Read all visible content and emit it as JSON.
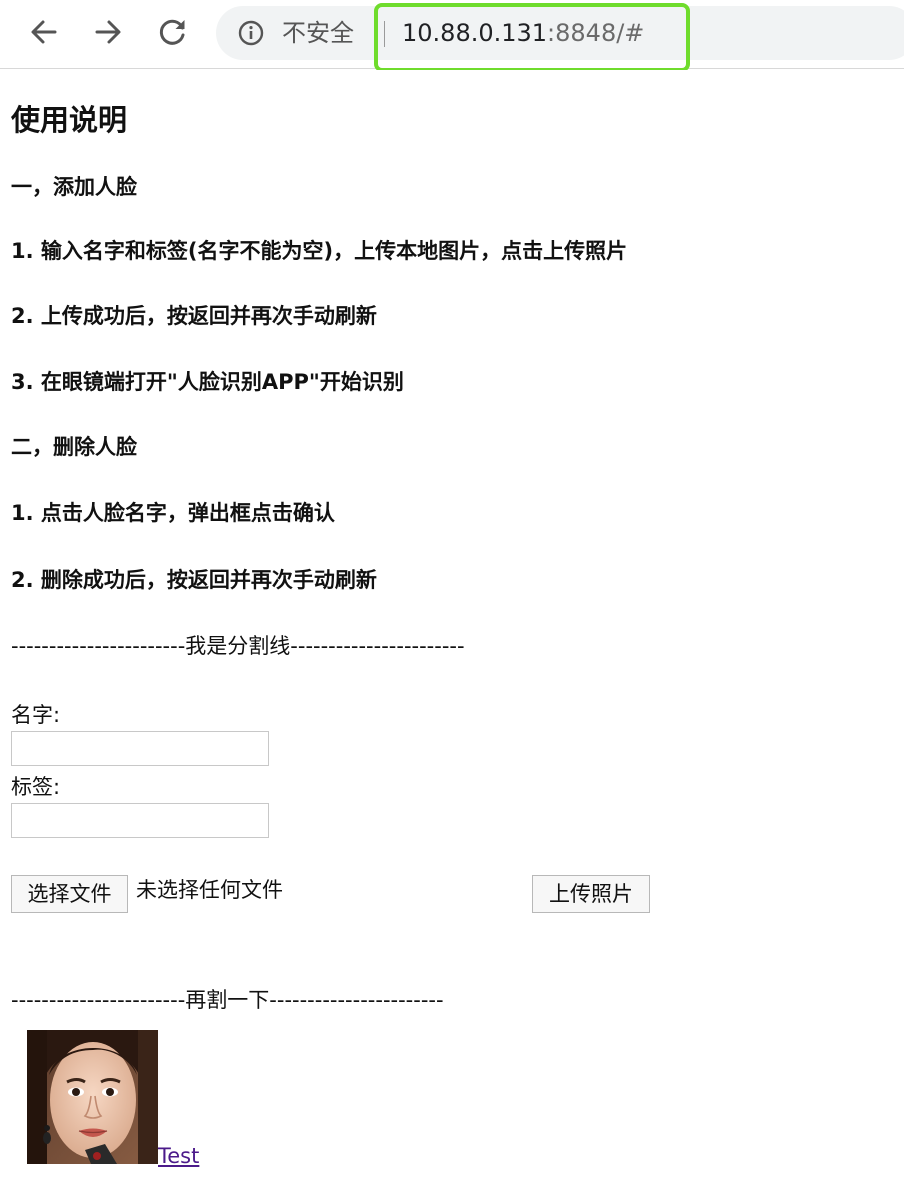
{
  "browser": {
    "security_label": "不安全",
    "url_host": "10.88.0.131",
    "url_rest": ":8848/#"
  },
  "instructions": {
    "title": "使用说明",
    "section1_heading": "一，添加人脸",
    "section1_steps": [
      "1. 输入名字和标签(名字不能为空)，上传本地图片，点击上传照片",
      "2. 上传成功后，按返回并再次手动刷新",
      "3. 在眼镜端打开\"人脸识别APP\"开始识别"
    ],
    "section2_heading": "二，删除人脸",
    "section2_steps": [
      "1. 点击人脸名字，弹出框点击确认",
      "2. 删除成功后，按返回并再次手动刷新"
    ]
  },
  "dividers": {
    "first": "-----------------------我是分割线-----------------------",
    "second": "-----------------------再割一下-----------------------"
  },
  "form": {
    "name_label": "名字:",
    "name_value": "",
    "tag_label": "标签:",
    "tag_value": "",
    "choose_file_label": "选择文件",
    "no_file_text": "未选择任何文件",
    "upload_label": "上传照片"
  },
  "faces": [
    {
      "name": "Test"
    }
  ]
}
